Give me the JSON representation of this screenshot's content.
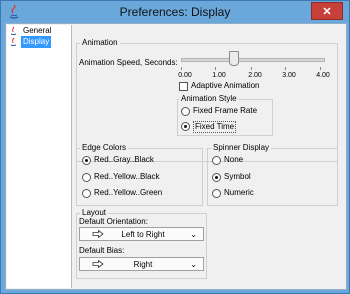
{
  "window": {
    "title": "Preferences: Display",
    "close_glyph": "✕",
    "app_icon": "java-icon"
  },
  "tree": {
    "items": [
      {
        "label": "General",
        "selected": false,
        "icon": "java-icon"
      },
      {
        "label": "Display",
        "selected": true,
        "icon": "java-icon"
      }
    ]
  },
  "animation": {
    "group_label": "Animation",
    "speed_label": "Animation Speed, Seconds:",
    "tick_labels": [
      "0.00",
      "1.00",
      "2.00",
      "3.00",
      "4.00"
    ],
    "slider_value": 1.5,
    "slider_max": 4,
    "adaptive_label": "Adaptive Animation",
    "adaptive_checked": false,
    "style": {
      "group_label": "Animation Style",
      "options": [
        "Fixed Frame Rate",
        "Fixed Time"
      ],
      "selected": "Fixed Time"
    }
  },
  "edge_colors": {
    "group_label": "Edge Colors",
    "options": [
      "Red..Gray..Black",
      "Red..Yellow..Black",
      "Red..Yellow..Green"
    ],
    "selected": "Red..Gray..Black"
  },
  "spinner": {
    "group_label": "Spinner Display",
    "options": [
      "None",
      "Symbol",
      "Numeric"
    ],
    "selected": "Symbol"
  },
  "layout": {
    "group_label": "Layout",
    "orientation_label": "Default Orientation:",
    "orientation_value": "Left to Right",
    "bias_label": "Default Bias:",
    "bias_value": "Right",
    "arrow_icon": "arrow-right-icon",
    "chevron_icon": "chevron-down-icon"
  },
  "colors": {
    "selection": "#3399ff",
    "titlebar": "#6aa8dc",
    "close": "#c7413a"
  }
}
